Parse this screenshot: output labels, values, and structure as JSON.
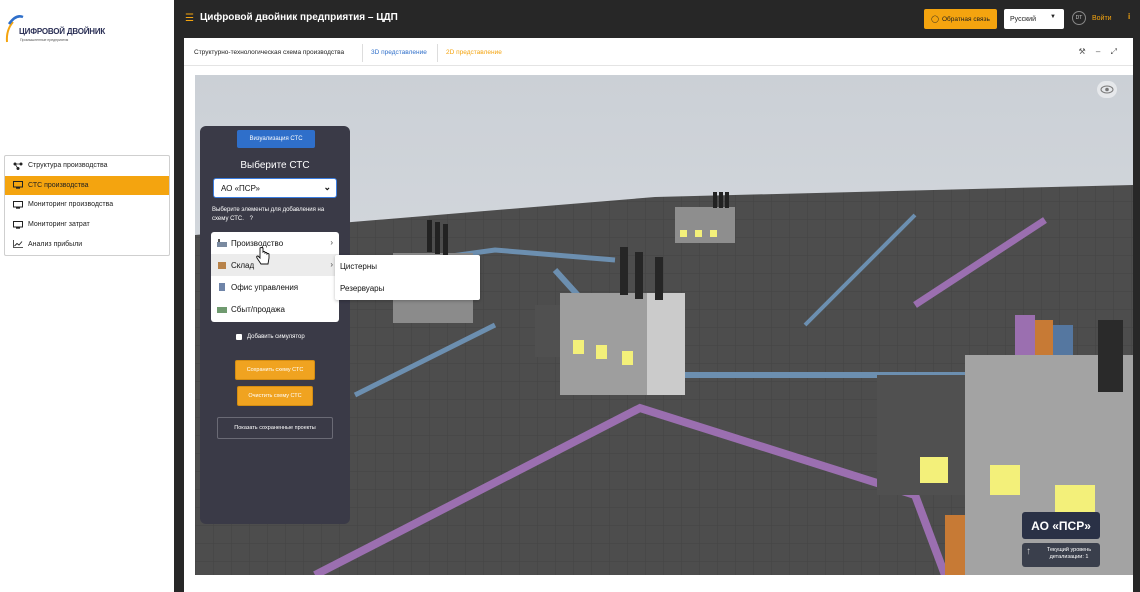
{
  "logo": {
    "title": "ЦИФРОВОЙ ДВОЙНИК",
    "subtitle": "Промышленные предприятия"
  },
  "sidebar": {
    "items": [
      {
        "label": "Структура производства",
        "icon": "structure-icon"
      },
      {
        "label": "СТС производства",
        "icon": "monitor-icon",
        "active": true
      },
      {
        "label": "Мониторинг производства",
        "icon": "monitor-icon"
      },
      {
        "label": "Мониторинг затрат",
        "icon": "monitor-icon"
      },
      {
        "label": "Анализ прибыли",
        "icon": "chart-icon"
      }
    ]
  },
  "header": {
    "title": "Цифровой двойник предприятия – ЦДП",
    "feedback_label": "Обратная связь",
    "language": "Русский",
    "login_label": "Войти",
    "avatar_text": "DT",
    "info_icon": "i"
  },
  "tabs": [
    {
      "label": "Структурно-технологическая схема производства",
      "active": true
    },
    {
      "label": "3D представление"
    },
    {
      "label": "2D представление",
      "highlight": true
    }
  ],
  "tab_tools": "⚒ – ⤢",
  "control_panel": {
    "viz_button": "Визуализация СТС",
    "choose_title": "Выберите СТС",
    "selected": "АО «ПСР»",
    "hint": "Выберите элементы для добавления на схему СТС.",
    "hint_q": "?",
    "menu": [
      {
        "label": "Производство",
        "has_sub": true
      },
      {
        "label": "Склад",
        "has_sub": true
      },
      {
        "label": "Офис управления",
        "has_sub": false
      },
      {
        "label": "Сбыт/продажа",
        "has_sub": false
      }
    ],
    "submenu": [
      "Цистерны",
      "Резервуары"
    ],
    "simulator_label": "Добавить симулятор",
    "save_button": "Сохранить схему СТС",
    "clear_button": "Очистить схему СТС",
    "projects_button": "Показать сохраненные проекты"
  },
  "scene": {
    "org_label": "АО «ПСР»",
    "level_line1": "Текущий уровень",
    "level_line2": "детализации: 1"
  },
  "colors": {
    "accent": "#f4a40f",
    "topbar": "#272727",
    "panel": "#3a3a47",
    "primary": "#2f6fca"
  }
}
